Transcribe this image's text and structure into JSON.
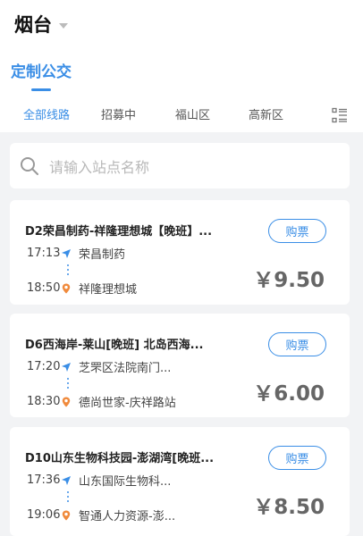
{
  "header": {
    "city": "烟台",
    "main_tab": "定制公交"
  },
  "subtabs": [
    "全部线路",
    "招募中",
    "福山区",
    "高新区"
  ],
  "search": {
    "placeholder": "请输入站点名称"
  },
  "routes": [
    {
      "title": "D2荣昌制药-祥隆理想城【晚班】...",
      "start_time": "17:13",
      "start_stop": "荣昌制药",
      "end_time": "18:50",
      "end_stop": "祥隆理想城",
      "buy_label": "购票",
      "price": "￥9.50"
    },
    {
      "title": "D6西海岸-莱山[晚班] 北岛西海...",
      "start_time": "17:20",
      "start_stop": "芝罘区法院南门...",
      "end_time": "18:30",
      "end_stop": "德尚世家-庆祥路站",
      "buy_label": "购票",
      "price": "￥6.00"
    },
    {
      "title": "D10山东生物科技园-澎湖湾[晚班...",
      "start_time": "17:36",
      "start_stop": "山东国际生物科...",
      "end_time": "19:06",
      "end_stop": "智通人力资源-澎...",
      "buy_label": "购票",
      "price": "￥8.50"
    }
  ],
  "colors": {
    "accent": "#3a8ee6",
    "end_marker": "#f08a3c"
  }
}
